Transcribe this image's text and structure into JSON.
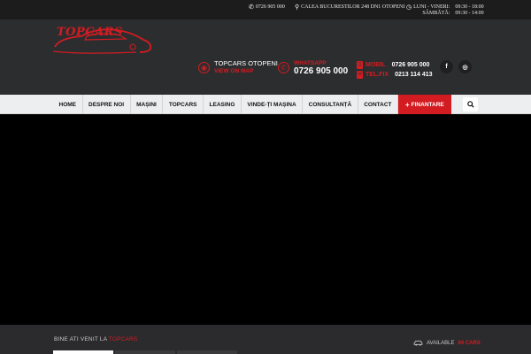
{
  "topbar": {
    "phone": "0726 905 000",
    "address": "CALEA BUCURESTILOR 248 DN1 OTOPENI",
    "hours": [
      {
        "day": "LUNI - VINERI:",
        "time": "09:30 - 18:00"
      },
      {
        "day": "SÂMBĂTĂ:",
        "time": "09:30 - 14:00"
      }
    ]
  },
  "header": {
    "logo_text": "TOPCARS",
    "location_title": "TOPCARS OTOPENI",
    "location_link": "VIEW ON MAP",
    "whatsapp_label": "WHATSAPP",
    "whatsapp_number": "0726 905 000",
    "mobil_label": "MOBIL",
    "mobil_number": "0726 905 000",
    "telfix_label": "TEL.FIX",
    "telfix_number": "0213 114 413",
    "social": {
      "facebook": "f",
      "instagram": "◎"
    }
  },
  "nav": {
    "items": [
      "HOME",
      "DESPRE NOI",
      "MAȘINI",
      "TOPCARS",
      "LEASING",
      "VINDE-ȚI MAȘINA",
      "CONSULTANȚĂ",
      "CONTACT"
    ],
    "finance": "FINANTARE"
  },
  "footer": {
    "welcome_prefix": "BINE ATI VENIT LA ",
    "welcome_brand": "TOPCARS",
    "available_prefix": "AVAILABLE ",
    "available_count": "94 CARS"
  },
  "colors": {
    "accent": "#d31c22",
    "header_bg": "#2c2d2f",
    "topbar_bg": "#1c1c1c",
    "nav_bg": "#eceef0"
  }
}
